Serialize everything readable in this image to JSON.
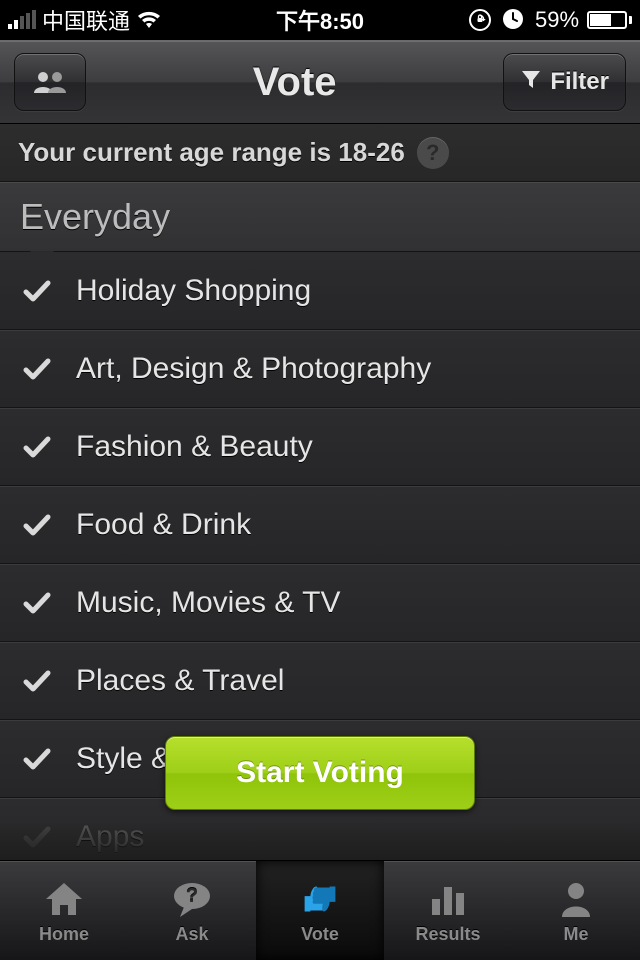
{
  "status": {
    "carrier": "中国联通",
    "time": "下午8:50",
    "battery_pct": "59%"
  },
  "nav": {
    "title": "Vote",
    "filter_label": "Filter"
  },
  "info": {
    "age_text": "Your current age range is 18-26",
    "help_symbol": "?"
  },
  "section": {
    "title": "Everyday"
  },
  "rows": [
    {
      "label": "Holiday Shopping"
    },
    {
      "label": "Art, Design & Photography"
    },
    {
      "label": "Fashion & Beauty"
    },
    {
      "label": "Food & Drink"
    },
    {
      "label": "Music, Movies & TV"
    },
    {
      "label": "Places & Travel"
    },
    {
      "label": "Style & Appearance"
    },
    {
      "label": "Apps"
    }
  ],
  "cta": {
    "start_label": "Start Voting"
  },
  "tabs": {
    "home": "Home",
    "ask": "Ask",
    "vote": "Vote",
    "results": "Results",
    "me": "Me"
  }
}
